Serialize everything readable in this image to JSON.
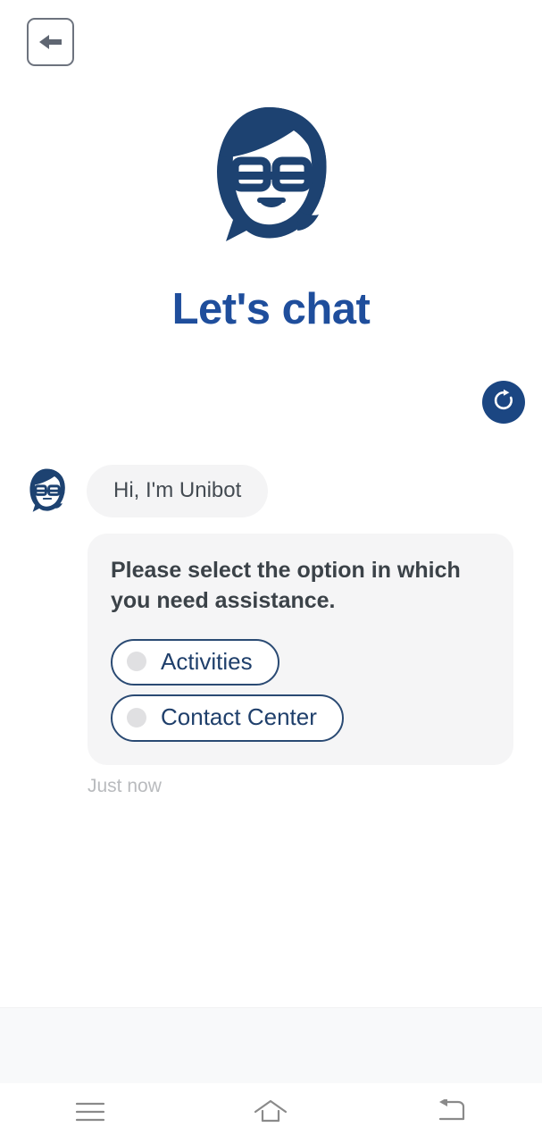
{
  "app": {
    "background_color": "#ffffff",
    "brand_color": "#1b4682",
    "title_color": "#1f4e9c"
  },
  "header": {
    "back_button": {
      "icon": "arrow-left-icon",
      "label": ""
    }
  },
  "hero": {
    "logo_icon": "unibot-face-logo",
    "logo_color": "#1d4271",
    "title": "Let's chat"
  },
  "actions": {
    "refresh": {
      "icon": "refresh-icon",
      "label": "",
      "background_color": "#1b4682"
    }
  },
  "chat": {
    "avatar_icon": "unibot-avatar",
    "greeting": {
      "text": "Hi, I'm Unibot",
      "bubble_color": "#f4f4f5",
      "text_color": "#444b52"
    },
    "options_message": {
      "prompt": "Please select the option in which you need assistance.",
      "bubble_color": "#f5f5f6",
      "options": [
        {
          "label": "Activities",
          "bullet_icon": "radio-dot-icon"
        },
        {
          "label": "Contact Center",
          "bullet_icon": "radio-dot-icon"
        }
      ]
    },
    "timestamp": "Just now"
  },
  "composer": {
    "placeholder": "",
    "value": "",
    "background_color": "#f8f9fa"
  },
  "system_nav": {
    "recents": {
      "icon": "menu-icon",
      "label": ""
    },
    "home": {
      "icon": "home-icon",
      "label": ""
    },
    "back": {
      "icon": "back-arrow-icon",
      "label": ""
    }
  }
}
